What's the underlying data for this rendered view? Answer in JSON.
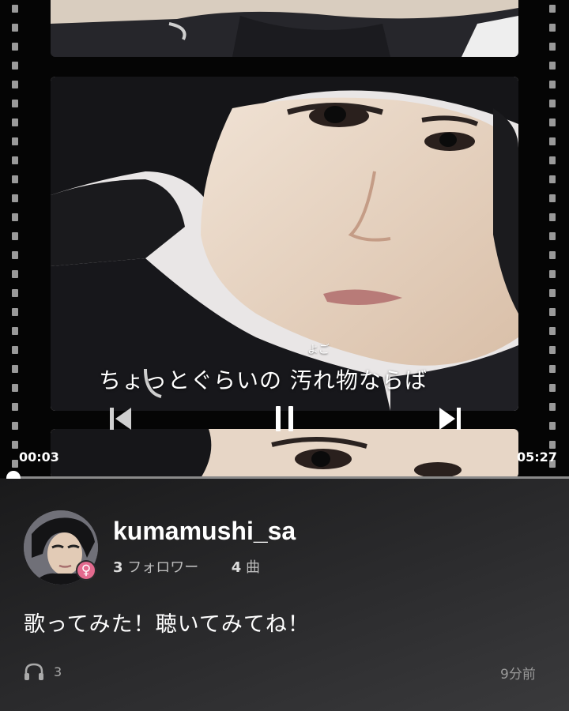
{
  "player": {
    "lyric_ruby": "よご",
    "lyric_line": "ちょっとぐらいの  汚れ物ならば",
    "current_time": "00:03",
    "total_time": "05:27",
    "progress": 0.01
  },
  "profile": {
    "username": "kumamushi_sa",
    "followers_count": "3",
    "followers_label": "フォロワー",
    "songs_count": "4",
    "songs_label": "曲",
    "gender_symbol": "♀"
  },
  "post": {
    "description": "歌ってみた！聴いてみてね！",
    "listen_count": "3",
    "posted_ago": "9分前"
  },
  "icons": {
    "prev": "skip-previous-icon",
    "pause": "pause-icon",
    "next": "skip-next-icon",
    "headphones": "headphones-icon",
    "gender": "female-icon"
  },
  "colors": {
    "gender_badge": "#e36a8e",
    "progress_track": "#8a8a8a",
    "panel_bg": "#2b2b2d"
  }
}
